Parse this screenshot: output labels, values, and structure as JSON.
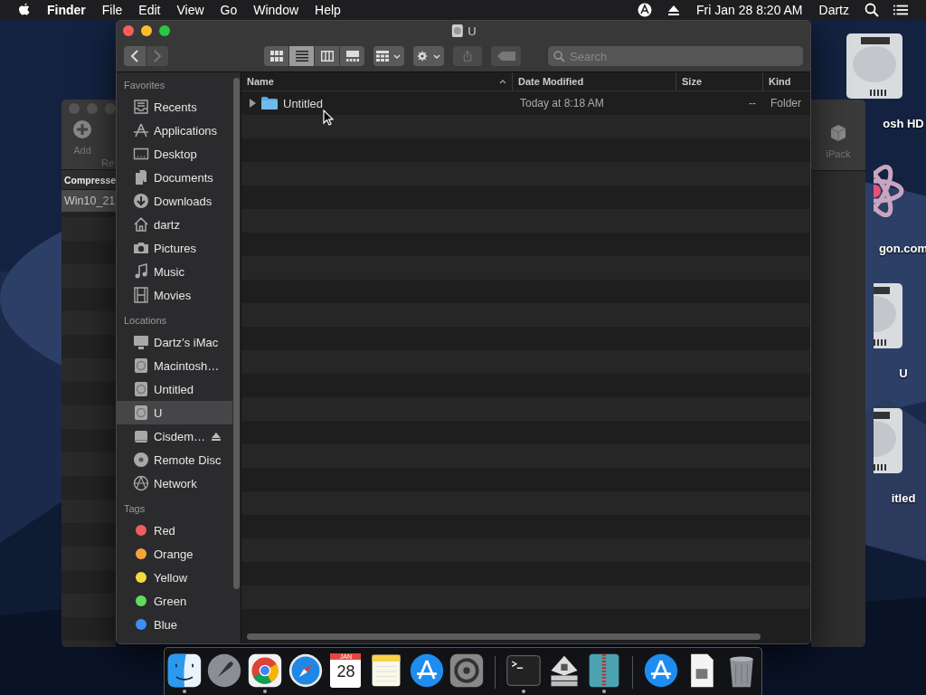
{
  "menu_bar": {
    "app": "Finder",
    "items": [
      "File",
      "Edit",
      "View",
      "Go",
      "Window",
      "Help"
    ],
    "clock": "Fri Jan 28  8:20 AM",
    "user": "Dartz"
  },
  "desktop_icons": [
    {
      "label": "osh HD",
      "kind": "drive"
    },
    {
      "label": "gon.com",
      "kind": "logo"
    },
    {
      "label": "U",
      "kind": "drive"
    },
    {
      "label": "itled",
      "kind": "drive"
    }
  ],
  "back_window": {
    "tools": [
      "Add",
      "Re"
    ],
    "right_tool": "iPack",
    "column": "Compresse",
    "rows": [
      {
        "name": "Win10_21",
        "selected": true
      }
    ]
  },
  "finder": {
    "title": "U",
    "back_enabled": true,
    "forward_enabled": false,
    "views": [
      {
        "kind": "icons",
        "selected": false
      },
      {
        "kind": "list",
        "selected": true
      },
      {
        "kind": "columns",
        "selected": false
      },
      {
        "kind": "gallery",
        "selected": false
      }
    ],
    "share_enabled": false,
    "tags_enabled": false,
    "search": {
      "placeholder": "Search"
    },
    "sidebar": [
      {
        "heading": "Favorites",
        "items": [
          {
            "label": "Recents",
            "kind": "recents",
            "selected": false
          },
          {
            "label": "Applications",
            "kind": "apps",
            "selected": false
          },
          {
            "label": "Desktop",
            "kind": "desktop",
            "selected": false
          },
          {
            "label": "Documents",
            "kind": "documents",
            "selected": false
          },
          {
            "label": "Downloads",
            "kind": "downloads",
            "selected": false
          },
          {
            "label": "dartz",
            "kind": "home",
            "selected": false
          },
          {
            "label": "Pictures",
            "kind": "pictures",
            "selected": false
          },
          {
            "label": "Music",
            "kind": "music",
            "selected": false
          },
          {
            "label": "Movies",
            "kind": "movies",
            "selected": false
          }
        ]
      },
      {
        "heading": "Locations",
        "items": [
          {
            "label": "Dartz’s iMac",
            "kind": "computer",
            "selected": false
          },
          {
            "label": "Macintosh…",
            "kind": "disk",
            "selected": false
          },
          {
            "label": "Untitled",
            "kind": "disk",
            "selected": false
          },
          {
            "label": "U",
            "kind": "disk",
            "selected": true
          },
          {
            "label": "Cisdem…",
            "kind": "external",
            "selected": false,
            "ejectable": true
          },
          {
            "label": "Remote Disc",
            "kind": "disc",
            "selected": false
          },
          {
            "label": "Network",
            "kind": "network",
            "selected": false
          }
        ]
      },
      {
        "heading": "Tags",
        "items": [
          {
            "label": "Red",
            "kind": "tag",
            "color": "#ec5f5d",
            "selected": false
          },
          {
            "label": "Orange",
            "kind": "tag",
            "color": "#f5a43a",
            "selected": false
          },
          {
            "label": "Yellow",
            "kind": "tag",
            "color": "#f5dc3c",
            "selected": false
          },
          {
            "label": "Green",
            "kind": "tag",
            "color": "#5ddc5f",
            "selected": false
          },
          {
            "label": "Blue",
            "kind": "tag",
            "color": "#3b8ff5",
            "selected": false
          }
        ]
      }
    ],
    "columns": [
      {
        "label": "Name",
        "sorted": true
      },
      {
        "label": "Date Modified",
        "sorted": false
      },
      {
        "label": "Size",
        "sorted": false
      },
      {
        "label": "Kind",
        "sorted": false
      }
    ],
    "rows": [
      {
        "name": "Untitled",
        "expanded": false,
        "date": "Today at 8:18 AM",
        "size": "--",
        "kind": "Folder"
      }
    ]
  },
  "dock": [
    {
      "kind": "finder",
      "running": true
    },
    {
      "kind": "launchpad",
      "running": false
    },
    {
      "kind": "chrome",
      "running": true
    },
    {
      "kind": "safari",
      "running": false
    },
    {
      "kind": "calendar",
      "running": false,
      "month": "JAN",
      "day": "28"
    },
    {
      "kind": "notes",
      "running": false
    },
    {
      "kind": "appstore",
      "running": false
    },
    {
      "kind": "settings",
      "running": false
    },
    {
      "kind": "separator"
    },
    {
      "kind": "terminal",
      "running": true
    },
    {
      "kind": "utility",
      "running": false
    },
    {
      "kind": "archive",
      "running": true
    },
    {
      "kind": "separator"
    },
    {
      "kind": "appstore",
      "running": false
    },
    {
      "kind": "file",
      "running": false
    },
    {
      "kind": "trash",
      "running": false
    }
  ]
}
